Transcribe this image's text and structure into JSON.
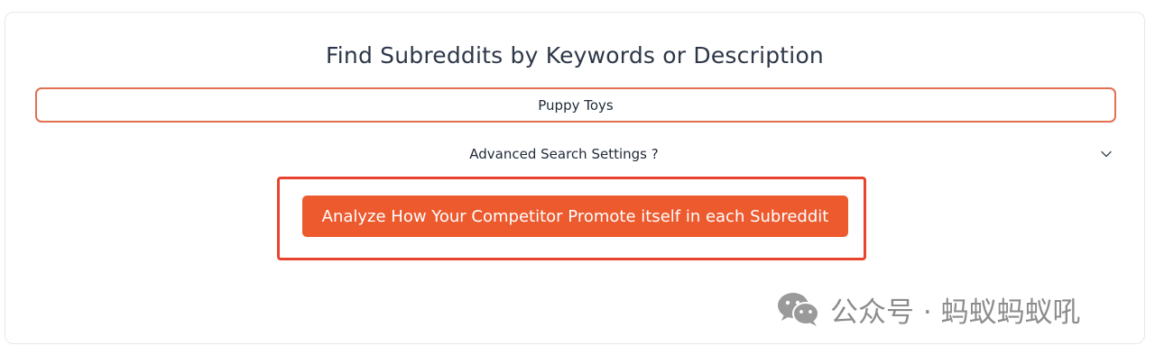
{
  "header": {
    "title": "Find Subreddits by Keywords or Description"
  },
  "search": {
    "value": "Puppy Toys"
  },
  "advanced": {
    "label": "Advanced Search Settings ?",
    "icon": "chevron-down-icon"
  },
  "action": {
    "analyze_label": "Analyze How Your Competitor Promote itself in each Subreddit"
  },
  "watermark": {
    "icon": "wechat-icon",
    "text": "公众号 · 蚂蚁蚂蚁吼"
  },
  "colors": {
    "accent": "#ec5a2e",
    "highlight_border": "#e8432d",
    "input_border": "#e0704f",
    "title_text": "#2d3748",
    "watermark": "#8c8c8c"
  }
}
